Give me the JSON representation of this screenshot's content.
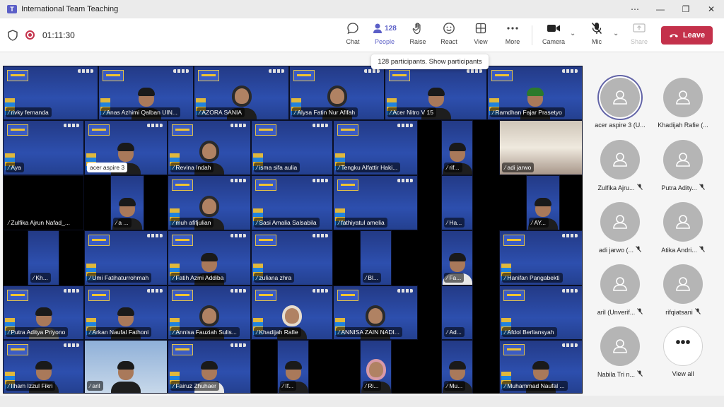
{
  "window": {
    "title": "International Team Teaching",
    "minimize": "⋯",
    "min": "—",
    "restore": "❐",
    "close": "✕"
  },
  "meeting": {
    "timer": "01:11:30"
  },
  "toolbar": {
    "chat": "Chat",
    "people": "People",
    "people_count": "128",
    "raise": "Raise",
    "react": "React",
    "view": "View",
    "more": "More",
    "camera": "Camera",
    "mic": "Mic",
    "share": "Share",
    "leave": "Leave"
  },
  "tooltip": "128 participants. Show participants",
  "tiles": [
    {
      "label": "rivky fernanda",
      "kind": "blue",
      "person": ""
    },
    {
      "label": "Anas Azhimi Qalban UIN...",
      "kind": "blue",
      "person": "p"
    },
    {
      "label": "AZORA SANIA",
      "kind": "blue",
      "person": "hijab"
    },
    {
      "label": "Alysa Fatin Nur Afifah",
      "kind": "blue",
      "person": "hijab"
    },
    {
      "label": "Acer Nitro V 15",
      "kind": "blue",
      "person": "p"
    },
    {
      "label": "Ramdhan Fajar Prasetyo",
      "kind": "blue",
      "person": "green"
    },
    {
      "label": "Aya",
      "kind": "blue",
      "person": ""
    },
    {
      "label": "acer aspire 3",
      "kind": "blue",
      "person": "p",
      "white": true
    },
    {
      "label": "Revina Indah",
      "kind": "blue",
      "person": "hijab"
    },
    {
      "label": "isma sifa aulia",
      "kind": "blue",
      "person": ""
    },
    {
      "label": "Tengku Alfattir Haki...",
      "kind": "blue",
      "person": ""
    },
    {
      "label": "rif...",
      "kind": "blue",
      "person": "p"
    },
    {
      "label": "adi jarwo",
      "kind": "room",
      "person": ""
    },
    {
      "label": "Zulfika Ajrun Nafad_...",
      "kind": "black",
      "person": ""
    },
    {
      "label": "a ...",
      "kind": "blue",
      "person": "p"
    },
    {
      "label": "muh afifjulian",
      "kind": "blue",
      "person": "hijab"
    },
    {
      "label": "Sasi Amalia Salsabila",
      "kind": "blue",
      "person": ""
    },
    {
      "label": "fathiyatul amelia",
      "kind": "blue",
      "person": ""
    },
    {
      "label": "Ha...",
      "kind": "blue",
      "person": ""
    },
    {
      "label": "AY...",
      "kind": "blue",
      "person": "p"
    },
    {
      "label": "Kh...",
      "kind": "blue",
      "person": ""
    },
    {
      "label": "Umi Fatihaturrohmah",
      "kind": "blue",
      "person": ""
    },
    {
      "label": "Fatih Azmi Addiba",
      "kind": "blue",
      "person": "p"
    },
    {
      "label": "zuliana zhra",
      "kind": "blue",
      "person": ""
    },
    {
      "label": "Bl...",
      "kind": "blue",
      "person": ""
    },
    {
      "label": "Fa...",
      "kind": "blue",
      "person": "white"
    },
    {
      "label": "Hanifan Pangabekti",
      "kind": "blue",
      "person": ""
    },
    {
      "label": "Putra Aditya Priyono",
      "kind": "blue",
      "person": "gray"
    },
    {
      "label": "Arkan Naufal Fathoni",
      "kind": "blue",
      "person": "p"
    },
    {
      "label": "Annisa Fauziah Sulis...",
      "kind": "blue",
      "person": "hijab"
    },
    {
      "label": "Khadijah Rafie",
      "kind": "blue",
      "person": "cream"
    },
    {
      "label": "ANNISA ZAIN NADI...",
      "kind": "blue",
      "person": "hijab"
    },
    {
      "label": "Ad...",
      "kind": "blue",
      "person": ""
    },
    {
      "label": "Afdol Berliansyah",
      "kind": "blue",
      "person": ""
    },
    {
      "label": "Ilham Izzul Fikri",
      "kind": "blue",
      "person": "p"
    },
    {
      "label": "aril",
      "kind": "light",
      "person": "p"
    },
    {
      "label": "Fairuz Zhuhaer",
      "kind": "blue",
      "person": "white"
    },
    {
      "label": "If...",
      "kind": "blue",
      "person": "p"
    },
    {
      "label": "Ri...",
      "kind": "blue",
      "person": "pink"
    },
    {
      "label": "Mu...",
      "kind": "blue",
      "person": "p"
    },
    {
      "label": "Muhammad Naufal ...",
      "kind": "blue",
      "person": "p"
    }
  ],
  "side_people": [
    {
      "name": "acer aspire 3 (U...",
      "muted": false,
      "speaking": true
    },
    {
      "name": "Khadijah Rafie (...",
      "muted": false,
      "speaking": false
    },
    {
      "name": "Zulfika Ajru...",
      "muted": true,
      "speaking": false
    },
    {
      "name": "Putra Adity...",
      "muted": true,
      "speaking": false
    },
    {
      "name": "adi jarwo (...",
      "muted": true,
      "speaking": false
    },
    {
      "name": "Atika Andri...",
      "muted": true,
      "speaking": false
    },
    {
      "name": "aril (Unverif...",
      "muted": true,
      "speaking": false
    },
    {
      "name": "rifqiatsani",
      "muted": true,
      "speaking": false
    },
    {
      "name": "Nabila Tri n...",
      "muted": true,
      "speaking": false
    }
  ],
  "view_all": {
    "label": "View all",
    "glyph": "•••"
  },
  "colors": {
    "accent": "#5b5fc7",
    "leave": "#c4314b",
    "speaking_ring": "#6264a7"
  }
}
